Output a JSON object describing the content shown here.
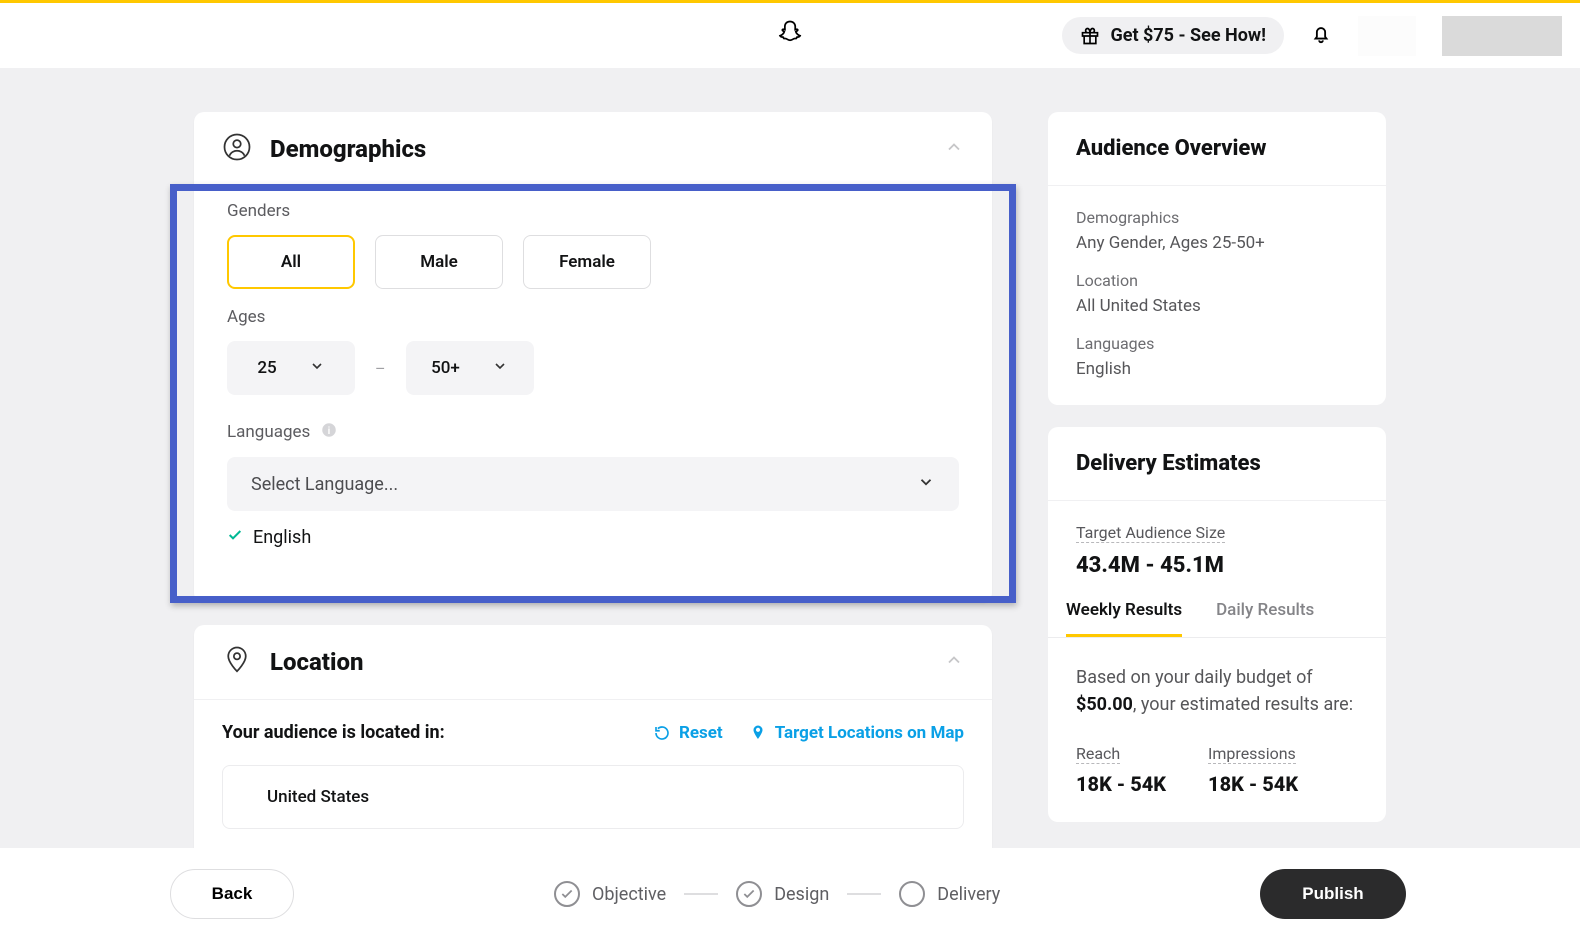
{
  "header": {
    "promo_label": "Get $75 - See How!"
  },
  "demographics": {
    "title": "Demographics",
    "genders_label": "Genders",
    "gender_options": {
      "all": "All",
      "male": "Male",
      "female": "Female"
    },
    "ages_label": "Ages",
    "age_min": "25",
    "age_max": "50+",
    "languages_label": "Languages",
    "language_placeholder": "Select Language...",
    "selected_language": "English"
  },
  "location": {
    "title": "Location",
    "prompt": "Your audience is located in:",
    "reset_label": "Reset",
    "map_label": "Target Locations on Map",
    "country": "United States"
  },
  "overview": {
    "title": "Audience Overview",
    "demographics_label": "Demographics",
    "demographics_value": "Any Gender, Ages 25-50+",
    "location_label": "Location",
    "location_value": "All United States",
    "languages_label": "Languages",
    "languages_value": "English"
  },
  "estimates": {
    "title": "Delivery Estimates",
    "audience_size_label": "Target Audience Size",
    "audience_size_value": "43.4M - 45.1M",
    "tabs": {
      "weekly": "Weekly Results",
      "daily": "Daily Results"
    },
    "budget_prefix": "Based on your daily budget of ",
    "budget_value": "$50.00",
    "budget_suffix": ", your estimated results are:",
    "reach_label": "Reach",
    "reach_value": "18K - 54K",
    "impressions_label": "Impressions",
    "impressions_value": "18K - 54K"
  },
  "footer": {
    "back": "Back",
    "publish": "Publish",
    "steps": {
      "objective": "Objective",
      "design": "Design",
      "delivery": "Delivery"
    }
  }
}
